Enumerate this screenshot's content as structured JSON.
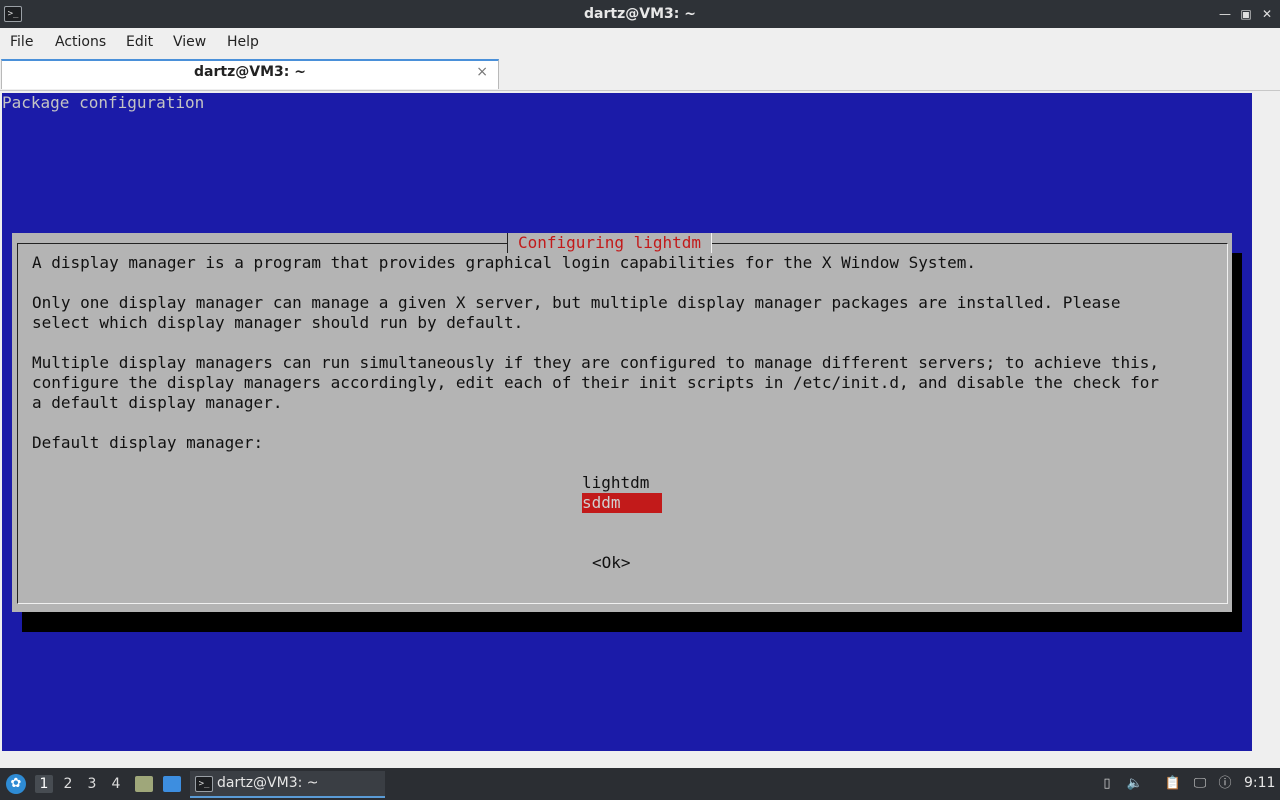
{
  "window": {
    "title": "dartz@VM3: ~"
  },
  "menu": [
    "File",
    "Actions",
    "Edit",
    "View",
    "Help"
  ],
  "tab": {
    "label": "dartz@VM3: ~",
    "close": "×"
  },
  "terminal": {
    "header": "Package configuration",
    "dialog": {
      "title": "Configuring lightdm",
      "lines": [
        "A display manager is a program that provides graphical login capabilities for the X Window System.",
        "Only one display manager can manage a given X server, but multiple display manager packages are installed. Please",
        "select which display manager should run by default.",
        "Multiple display managers can run simultaneously if they are configured to manage different servers; to achieve this,",
        "configure the display managers accordingly, edit each of their init scripts in /etc/init.d, and disable the check for",
        "a default display manager.",
        "Default display manager:"
      ],
      "options": [
        "lightdm",
        "sddm"
      ],
      "selected_option": "sddm",
      "ok_button": "<Ok>"
    }
  },
  "taskbar": {
    "workspaces": [
      "1",
      "2",
      "3",
      "4"
    ],
    "active_workspace": "1",
    "task_label": "dartz@VM3: ~",
    "clock": "9:11",
    "icons": [
      "start-menu-icon",
      "file-manager-icon",
      "show-desktop-icon",
      "terminal-icon",
      "removable-media-icon",
      "volume-icon",
      "clipboard-icon",
      "network-icon",
      "notification-icon"
    ]
  },
  "colors": {
    "terminal_bg": "#1b1ba8",
    "dialog_bg": "#b4b4b4",
    "accent_red": "#c21a1a",
    "titlebar_bg": "#2e3237"
  }
}
